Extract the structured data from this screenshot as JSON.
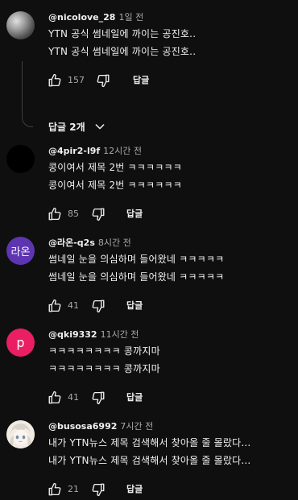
{
  "comments": [
    {
      "author": "@nicolove_28",
      "time": "1일 전",
      "lines": [
        "YTN 공식 썸네일에 까이는 공진호..",
        "YTN 공식 썸네일에 까이는 공진호.."
      ],
      "likes": "157",
      "reply_label": "답글",
      "avatar": {
        "kind": "photo-gray",
        "text": ""
      }
    },
    {
      "author": "@4pir2-l9f",
      "time": "12시간 전",
      "lines": [
        "콩이여서 제목 2번 ㅋㅋㅋㅋㅋㅋ",
        "콩이여서 제목 2번 ㅋㅋㅋㅋㅋㅋ"
      ],
      "likes": "85",
      "reply_label": "답글",
      "avatar": {
        "kind": "black",
        "text": ""
      }
    },
    {
      "author": "@라온-q2s",
      "time": "8시간 전",
      "lines": [
        "썸네일 눈을 의심하며 들어왔네 ㅋㅋㅋㅋㅋ",
        "썸네일 눈을 의심하며 들어왔네 ㅋㅋㅋㅋㅋ"
      ],
      "likes": "41",
      "reply_label": "답글",
      "avatar": {
        "kind": "letter",
        "text": "라온",
        "color": "#5e35b1"
      }
    },
    {
      "author": "@qki9332",
      "time": "11시간 전",
      "lines": [
        "ㅋㅋㅋㅋㅋㅋㅋㅋ 콩까지마",
        "ㅋㅋㅋㅋㅋㅋㅋㅋ 콩까지마"
      ],
      "likes": "41",
      "reply_label": "답글",
      "avatar": {
        "kind": "letter",
        "text": "p",
        "color": "#e91e63"
      }
    },
    {
      "author": "@busosa6992",
      "time": "7시간 전",
      "lines": [
        "내가 YTN뉴스 제목 검색해서 찾아올 줄 몰랐다...",
        "내가 YTN뉴스 제목 검색해서 찾아올 줄 몰랐다..."
      ],
      "likes": "21",
      "reply_label": "답글",
      "avatar": {
        "kind": "anime",
        "text": ""
      }
    }
  ],
  "replies_toggle": {
    "label": "답글 2개",
    "icon": "chevron-down-icon"
  },
  "colors": {
    "background": "#0f0f0f",
    "text": "#f1f1f1",
    "secondary": "#aaaaaa"
  }
}
